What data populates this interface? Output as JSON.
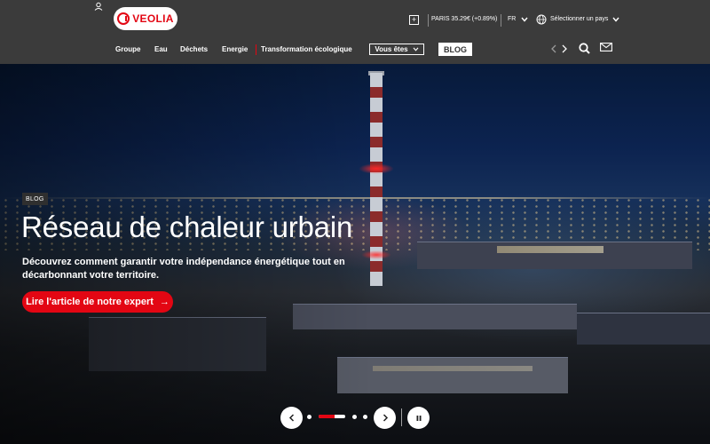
{
  "header": {
    "logo_text": "VEOLIA",
    "stock": "PARIS 35.29€ (+0.89%)",
    "language": "FR",
    "country_select": "Sélectionner un pays"
  },
  "nav": {
    "items": [
      {
        "label": "Groupe"
      },
      {
        "label": "Eau"
      },
      {
        "label": "Déchets"
      },
      {
        "label": "Energie"
      },
      {
        "label": "Transformation écologique"
      }
    ],
    "vous_etes": "Vous êtes",
    "blog": "BLOG"
  },
  "icons": {
    "home": "home-icon",
    "plus": "plus-icon",
    "globe": "globe-icon",
    "search": "search-icon",
    "mail": "mail-icon",
    "arrows": "chevron-left-right-icon"
  },
  "hero": {
    "badge": "BLOG",
    "title": "Réseau de chaleur urbain",
    "text": "Découvrez comment garantir votre indépendance énergétique tout en décarbonnant votre territoire.",
    "cta": "Lire l'article de notre expert",
    "cta_arrow": "→"
  },
  "carousel": {
    "slides": 5,
    "active_slide": 2,
    "progress": 0.6
  },
  "colors": {
    "accent": "#e30613",
    "header_bg": "#3b3b3b"
  }
}
